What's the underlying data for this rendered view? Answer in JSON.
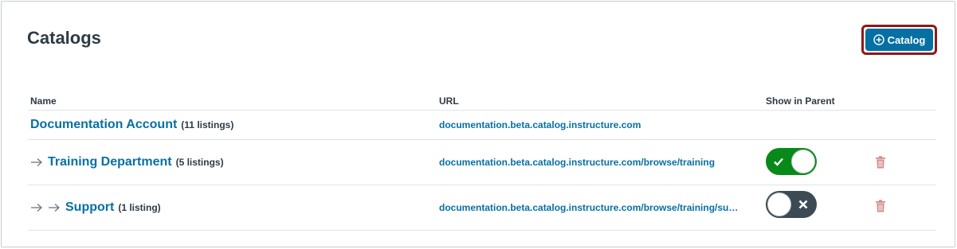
{
  "header": {
    "title": "Catalogs",
    "add_button_label": "Catalog"
  },
  "table": {
    "columns": {
      "name": "Name",
      "url": "URL",
      "show_in_parent": "Show in Parent"
    },
    "rows": [
      {
        "name": "Documentation Account",
        "listings": "(11 listings)",
        "url": "documentation.beta.catalog.instructure.com",
        "indent": 0
      },
      {
        "name": "Training Department",
        "listings": "(5 listings)",
        "url": "documentation.beta.catalog.instructure.com/browse/training",
        "indent": 1,
        "show_in_parent": true
      },
      {
        "name": "Support",
        "listings": "(1 listing)",
        "url": "documentation.beta.catalog.instructure.com/browse/training/su…",
        "indent": 2,
        "show_in_parent": false
      }
    ]
  },
  "icons": {
    "add": "plus-circle-icon",
    "indent": "arrow-right-icon",
    "delete": "trash-icon",
    "toggle_on": "checkmark-icon",
    "toggle_off": "x-icon"
  },
  "colors": {
    "brand": "#0770a3",
    "toggle_on": "#088a1a",
    "toggle_off": "#3b4a55",
    "delete": "#d48a8a",
    "focus_ring": "#8b1a1a"
  }
}
